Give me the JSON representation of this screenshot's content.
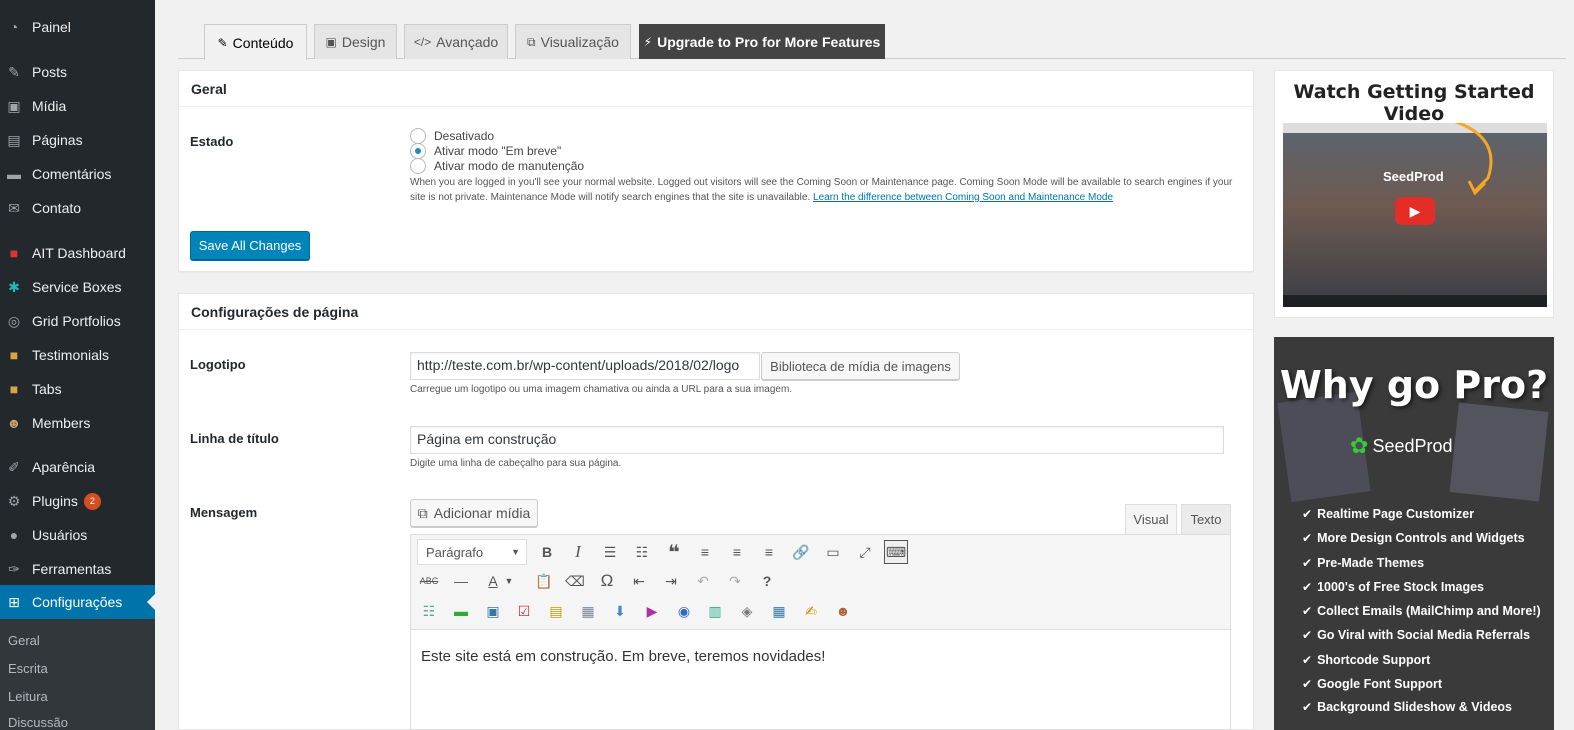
{
  "sidebar": {
    "items": [
      {
        "label": "Painel",
        "icon": "dashboard-icon"
      },
      {
        "label": "Posts",
        "icon": "pin-icon"
      },
      {
        "label": "Mídia",
        "icon": "media-icon"
      },
      {
        "label": "Páginas",
        "icon": "pages-icon"
      },
      {
        "label": "Comentários",
        "icon": "comments-icon"
      },
      {
        "label": "Contato",
        "icon": "mail-icon"
      },
      {
        "label": "AIT Dashboard",
        "icon": "ait-icon"
      },
      {
        "label": "Service Boxes",
        "icon": "gear-icon"
      },
      {
        "label": "Grid Portfolios",
        "icon": "circle-icon"
      },
      {
        "label": "Testimonials",
        "icon": "box-icon"
      },
      {
        "label": "Tabs",
        "icon": "box-icon"
      },
      {
        "label": "Members",
        "icon": "person-icon"
      },
      {
        "label": "Aparência",
        "icon": "brush-icon"
      },
      {
        "label": "Plugins",
        "icon": "plugin-icon",
        "badge": "2"
      },
      {
        "label": "Usuários",
        "icon": "user-icon"
      },
      {
        "label": "Ferramentas",
        "icon": "wrench-icon"
      },
      {
        "label": "Configurações",
        "icon": "settings-icon"
      }
    ],
    "submenu": [
      "Geral",
      "Escrita",
      "Leitura",
      "Discussão"
    ]
  },
  "tabs": [
    {
      "label": "Conteúdo",
      "icon": "✎"
    },
    {
      "label": "Design",
      "icon": "▣"
    },
    {
      "label": "Avançado",
      "icon": "</>"
    },
    {
      "label": "Visualização",
      "icon": "⧉"
    },
    {
      "label": "Upgrade to Pro for More Features",
      "icon": "⚡"
    }
  ],
  "geral": {
    "title": "Geral",
    "estado_label": "Estado",
    "options": [
      "Desativado",
      "Ativar modo \"Em breve\"",
      "Ativar modo de manutenção"
    ],
    "selected": 1,
    "description": "When you are logged in you'll see your normal website. Logged out visitors will see the Coming Soon or Maintenance page. Coming Soon Mode will be available to search engines if your site is not private. Maintenance Mode will notify search engines that the site is unavailable.",
    "link": "Learn the difference between Coming Soon and Maintenance Mode",
    "save_label": "Save All Changes"
  },
  "page_settings": {
    "title": "Configurações de página",
    "logo_label": "Logotipo",
    "logo_value": "http://teste.com.br/wp-content/uploads/2018/02/logo",
    "logo_button": "Biblioteca de mídia de imagens",
    "logo_help": "Carregue um logotipo ou uma imagem chamativa ou ainda a URL para a sua imagem.",
    "headline_label": "Linha de título",
    "headline_value": "Página em construção",
    "headline_help": "Digite uma linha de cabeçalho para sua página.",
    "message_label": "Mensagem",
    "add_media": "Adicionar mídia",
    "tab_visual": "Visual",
    "tab_text": "Texto",
    "format": "Parágrafo",
    "editor_content": "Este site está em construção. Em breve, teremos novidades!"
  },
  "video": {
    "title": "Watch Getting Started Video",
    "brand": "SeedProd"
  },
  "pro": {
    "title": "Why go Pro?",
    "brand": "SeedProd",
    "features": [
      "Realtime Page Customizer",
      "More Design Controls and Widgets",
      "Pre-Made Themes",
      "1000's of Free Stock Images",
      "Collect Emails (MailChimp and More!)",
      "Go Viral with Social Media Referrals",
      "Shortcode Support",
      "Google Font Support",
      "Background Slideshow & Videos"
    ]
  },
  "colors": {
    "sidebar_bg": "#23282d",
    "active": "#0073aa",
    "primary_button": "#0085ba",
    "badge": "#d54e21"
  }
}
